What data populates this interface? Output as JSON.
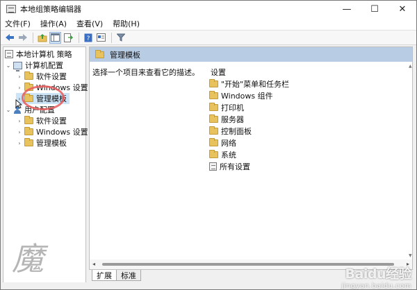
{
  "window": {
    "title": "本地组策略编辑器",
    "controls": {
      "minimize": "—",
      "maximize": "☐",
      "close": "✕"
    }
  },
  "menu": [
    "文件(F)",
    "操作(A)",
    "查看(V)",
    "帮助(H)"
  ],
  "toolbar": {
    "icons": [
      "back-arrow-icon",
      "forward-arrow-icon",
      "up-folder-icon",
      "show-hide-tree-icon",
      "export-list-icon",
      "help-icon",
      "properties-icon",
      "filter-icon"
    ]
  },
  "tree": {
    "root": "本地计算机 策略",
    "computer_config": "计算机配置",
    "computer_children": [
      "软件设置",
      "Windows 设置",
      "管理模板"
    ],
    "user_config": "用户配置",
    "user_children": [
      "软件设置",
      "Windows 设置",
      "管理模板"
    ]
  },
  "right_pane": {
    "header": "管理模板",
    "description": "选择一个项目来查看它的描述。",
    "column_header": "设置",
    "items": [
      "\"开始\"菜单和任务栏",
      "Windows 组件",
      "打印机",
      "服务器",
      "控制面板",
      "网络",
      "系统",
      "所有设置"
    ]
  },
  "tabs": [
    "扩展",
    "标准"
  ],
  "watermark": {
    "char": "魔",
    "logo": "Baidu经验",
    "url": "jingyan.baidu.com"
  },
  "colors": {
    "header_bg": "#b8cce4",
    "folder": "#e8c25d",
    "annotation_circle": "#e85b5b"
  }
}
